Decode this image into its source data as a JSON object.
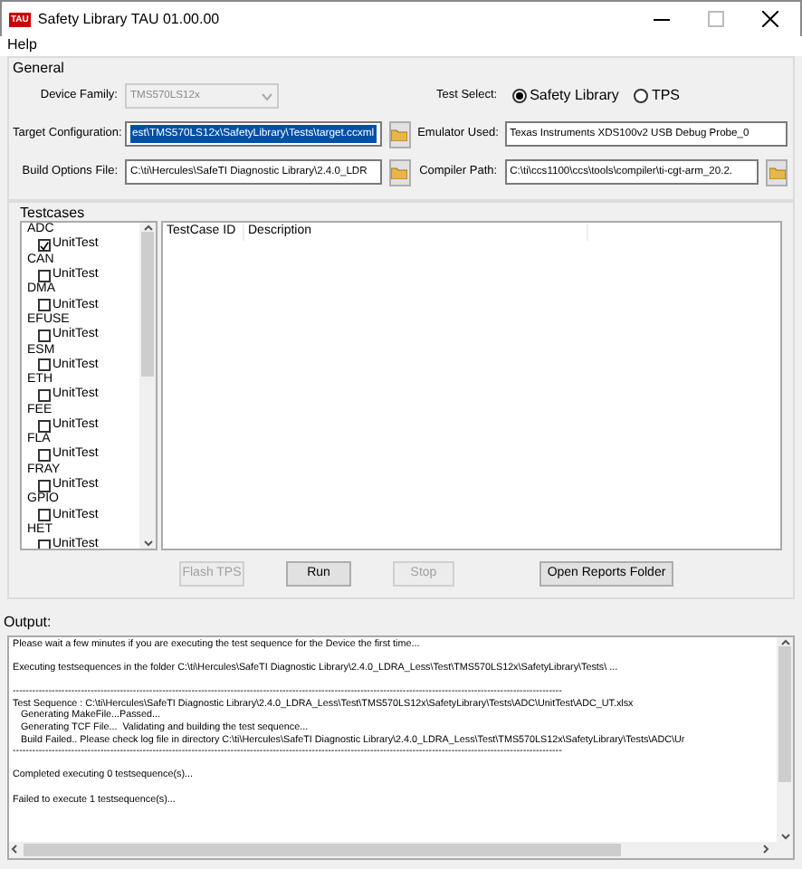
{
  "window": {
    "title": "Safety Library TAU 01.00.00",
    "logo": "TAU"
  },
  "menu": [
    "Help"
  ],
  "general": {
    "title": "General",
    "fields": [
      {
        "label": "Device Family:",
        "value": "TMS570LS12x",
        "kind": "combo",
        "disabled": true
      },
      {
        "label": "Target Configuration:",
        "value": "est\\TMS570LS12x\\SafetyLibrary\\Tests\\target.ccxml",
        "kind": "browse",
        "highlighted": true
      },
      {
        "label": "Build Options File:",
        "value": "C:\\ti\\Hercules\\SafeTI Diagnostic Library\\2.4.0_LDR",
        "kind": "browse",
        "highlighted": false
      }
    ],
    "test_select": {
      "label": "Test Select:",
      "options": [
        {
          "label": "Safety Library",
          "selected": true
        },
        {
          "label": "TPS",
          "selected": false
        }
      ]
    },
    "right_fields": [
      {
        "label": "Emulator Used:",
        "value": "Texas Instruments XDS100v2 USB Debug Probe_0",
        "kind": "text"
      },
      {
        "label": "Compiler Path:",
        "value": "C:\\ti\\ccs1100\\ccs\\tools\\compiler\\ti-cgt-arm_20.2.",
        "kind": "browse"
      }
    ]
  },
  "testcases": {
    "title": "Testcases",
    "tree": [
      {
        "label": "ADC",
        "children": [
          {
            "label": "UnitTest",
            "checked": true
          }
        ]
      },
      {
        "label": "CAN",
        "children": [
          {
            "label": "UnitTest",
            "checked": false
          }
        ]
      },
      {
        "label": "DMA",
        "children": [
          {
            "label": "UnitTest",
            "checked": false
          }
        ]
      },
      {
        "label": "EFUSE",
        "children": [
          {
            "label": "UnitTest",
            "checked": false
          }
        ]
      },
      {
        "label": "ESM",
        "children": [
          {
            "label": "UnitTest",
            "checked": false
          }
        ]
      },
      {
        "label": "ETH",
        "children": [
          {
            "label": "UnitTest",
            "checked": false
          }
        ]
      },
      {
        "label": "FEE",
        "children": [
          {
            "label": "UnitTest",
            "checked": false
          }
        ]
      },
      {
        "label": "FLA",
        "children": [
          {
            "label": "UnitTest",
            "checked": false
          }
        ]
      },
      {
        "label": "FRAY",
        "children": [
          {
            "label": "UnitTest",
            "checked": false
          }
        ]
      },
      {
        "label": "GPIO",
        "children": [
          {
            "label": "UnitTest",
            "checked": false
          }
        ]
      },
      {
        "label": "HET",
        "children": [
          {
            "label": "UnitTest",
            "checked": false
          }
        ]
      }
    ],
    "table": {
      "columns": [
        "TestCase ID",
        "Description"
      ]
    },
    "buttons": [
      {
        "label": "Flash TPS",
        "disabled": true
      },
      {
        "label": "Run",
        "disabled": false
      },
      {
        "label": "Stop",
        "disabled": true
      },
      {
        "label": "Open Reports Folder",
        "disabled": false
      }
    ]
  },
  "output": {
    "label": "Output:",
    "paragraphs": [
      [
        "Please wait a few minutes if you are executing the test sequence for the Device the first time..."
      ],
      [
        "Executing testsequences in the folder C:\\ti\\Hercules\\SafeTI Diagnostic Library\\2.4.0_LDRA_Less\\Test\\TMS570LS12x\\SafetyLibrary\\Tests\\ ..."
      ],
      [
        "-------------------------------------------------------------------------------------------------------------------------------------------------------------------------",
        "Test Sequence : C:\\ti\\Hercules\\SafeTI Diagnostic Library\\2.4.0_LDRA_Less\\Test\\TMS570LS12x\\SafetyLibrary\\Tests\\ADC\\UnitTest\\ADC_UT.xlsx",
        "   Generating MakeFile...Passed...",
        "   Generating TCF File...  Validating and building the test sequence...",
        "   Build Failed.. Please check log file in directory C:\\ti\\Hercules\\SafeTI Diagnostic Library\\2.4.0_LDRA_Less\\Test\\TMS570LS12x\\SafetyLibrary\\Tests\\ADC\\Ur",
        "-------------------------------------------------------------------------------------------------------------------------------------------------------------------------"
      ],
      [
        "Completed executing 0 testsequence(s)..."
      ],
      [
        "Failed to execute 1 testsequence(s)..."
      ]
    ]
  }
}
